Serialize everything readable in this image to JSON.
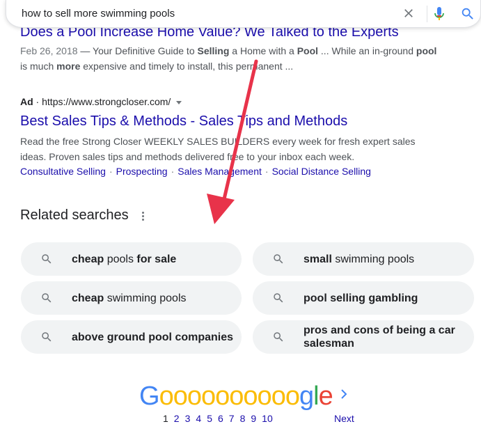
{
  "search": {
    "query": "how to sell more swimming pools"
  },
  "result1": {
    "title": "Does a Pool Increase Home Value? We Talked to the Experts",
    "date": "Feb 26, 2018",
    "snippet_line1_parts": [
      "— Your Definitive Guide to ",
      "Selling",
      " a Home with a ",
      "Pool",
      " ... While an in-ground ",
      "pool"
    ],
    "snippet_line2_parts": [
      "is much ",
      "more",
      " expensive and timely to install, this permanent ..."
    ]
  },
  "ad": {
    "label": "Ad",
    "url": "https://www.strongcloser.com/",
    "title": "Best Sales Tips & Methods - Sales Tips and Methods",
    "snippet_line1": "Read the free Strong Closer WEEKLY SALES BUILDERS every week for fresh expert sales",
    "snippet_line2": "ideas. Proven sales tips and methods delivered free to your inbox each week.",
    "sitelinks": [
      "Consultative Selling",
      "Prospecting",
      "Sales Management",
      "Social Distance Selling"
    ]
  },
  "related": {
    "title": "Related searches",
    "items": [
      {
        "bold1": "cheap",
        "plain": " pools ",
        "bold2": "for sale"
      },
      {
        "bold1": "small",
        "plain": " swimming pools",
        "bold2": ""
      },
      {
        "bold1": "cheap",
        "plain": " swimming pools",
        "bold2": ""
      },
      {
        "bold1": "pool selling gambling",
        "plain": "",
        "bold2": ""
      },
      {
        "bold1": "above ground pool companies",
        "plain": "",
        "bold2": ""
      },
      {
        "bold1": "pros and cons of being a car salesman",
        "plain": "",
        "bold2": ""
      }
    ]
  },
  "pagination": {
    "logo_letters": [
      "G",
      "o",
      "o",
      "o",
      "o",
      "o",
      "o",
      "o",
      "o",
      "o",
      "o",
      "g",
      "l",
      "e"
    ],
    "pages": [
      "1",
      "2",
      "3",
      "4",
      "5",
      "6",
      "7",
      "8",
      "9",
      "10"
    ],
    "current_page": "1",
    "next_label": "Next"
  },
  "icons": {
    "clear": "close-icon",
    "mic": "microphone-icon",
    "search": "search-icon",
    "more": "more-vert-icon",
    "next": "chevron-right-icon",
    "annotation": "red-arrow"
  },
  "colors": {
    "link": "#1a0dab",
    "snippet": "#4d5156",
    "chip_bg": "#f1f3f4",
    "arrow": "#e8334a"
  }
}
